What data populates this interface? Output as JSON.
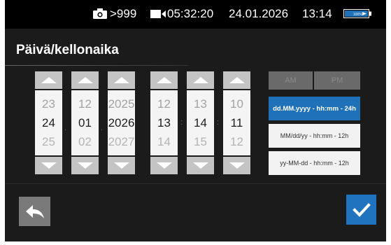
{
  "statusbar": {
    "photo_count": ">999",
    "video_duration": "05:32:20",
    "date": "24.01.2026",
    "time": "13:14",
    "battery_label": "100%"
  },
  "title": "Päivä/kellonaika",
  "pickers": [
    {
      "prev": "23",
      "current": "24",
      "next": "25"
    },
    {
      "prev": "12",
      "current": "01",
      "next": "02"
    },
    {
      "prev": "2025",
      "current": "2026",
      "next": "2027"
    },
    {
      "prev": "12",
      "current": "13",
      "next": "14"
    },
    {
      "prev": "13",
      "current": "14",
      "next": "15"
    },
    {
      "prev": "10",
      "current": "11",
      "next": "12"
    }
  ],
  "separators": {
    "date_sep": ".",
    "time_sep": ":"
  },
  "ampm": {
    "am": "AM",
    "pm": "PM"
  },
  "formats": [
    {
      "label": "dd.MM.yyyy - hh:mm - 24h",
      "selected": true
    },
    {
      "label": "MM/dd/yy - hh:mm - 12h",
      "selected": false
    },
    {
      "label": "yy-MM-dd - hh:mm - 12h",
      "selected": false
    }
  ],
  "colors": {
    "accent": "#1f71b8",
    "arrow_button": "#c4c4c4",
    "background": "#1b1b1b"
  }
}
